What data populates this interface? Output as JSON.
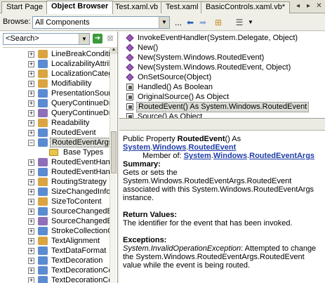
{
  "tabs": [
    {
      "label": "Start Page"
    },
    {
      "label": "Object Browser"
    },
    {
      "label": "Test.xaml.vb"
    },
    {
      "label": "Test.xaml"
    },
    {
      "label": "BasicControls.xaml.vb*"
    }
  ],
  "toolbar": {
    "browse_label": "Browse:",
    "browse_value": "All Components",
    "more_label": "..."
  },
  "search": {
    "placeholder": "<Search>"
  },
  "tree": [
    {
      "label": "LineBreakCondition",
      "icon_color": "#d9a441"
    },
    {
      "label": "LocalizabilityAttribut",
      "icon_color": "#5b8bd1"
    },
    {
      "label": "LocalizationCategor",
      "icon_color": "#d9a441"
    },
    {
      "label": "Modifiability",
      "icon_color": "#d9a441"
    },
    {
      "label": "PresentationSource",
      "icon_color": "#5b8bd1"
    },
    {
      "label": "QueryContinueDrag",
      "icon_color": "#5b8bd1"
    },
    {
      "label": "QueryContinueDrag",
      "icon_color": "#8e6fb8"
    },
    {
      "label": "Readability",
      "icon_color": "#d9a441"
    },
    {
      "label": "RoutedEvent",
      "icon_color": "#5b8bd1"
    },
    {
      "label": "RoutedEventArgs",
      "icon_color": "#5b8bd1"
    },
    {
      "label": "Base Types",
      "icon_color": "#e8c44c"
    },
    {
      "label": "RoutedEventHandle",
      "icon_color": "#8e6fb8"
    },
    {
      "label": "RoutedEventHandle",
      "icon_color": "#5b8bd1"
    },
    {
      "label": "RoutingStrategy",
      "icon_color": "#d9a441"
    },
    {
      "label": "SizeChangedInfo",
      "icon_color": "#5b8bd1"
    },
    {
      "label": "SizeToContent",
      "icon_color": "#d9a441"
    },
    {
      "label": "SourceChangedEve",
      "icon_color": "#5b8bd1"
    },
    {
      "label": "SourceChangedEve",
      "icon_color": "#8e6fb8"
    },
    {
      "label": "StrokeCollectionCor",
      "icon_color": "#5b8bd1"
    },
    {
      "label": "TextAlignment",
      "icon_color": "#d9a441"
    },
    {
      "label": "TextDataFormat",
      "icon_color": "#5b8bd1"
    },
    {
      "label": "TextDecoration",
      "icon_color": "#5b8bd1"
    },
    {
      "label": "TextDecorationColle",
      "icon_color": "#5b8bd1"
    },
    {
      "label": "TextDecorationColle",
      "icon_color": "#5b8bd1"
    }
  ],
  "members": [
    {
      "label": "InvokeEventHandler(System.Delegate, Object)",
      "kind": "method"
    },
    {
      "label": "New()",
      "kind": "method"
    },
    {
      "label": "New(System.Windows.RoutedEvent)",
      "kind": "method"
    },
    {
      "label": "New(System.Windows.RoutedEvent, Object)",
      "kind": "method"
    },
    {
      "label": "OnSetSource(Object)",
      "kind": "method"
    },
    {
      "label": "Handled() As Boolean",
      "kind": "property"
    },
    {
      "label": "OriginalSource() As Object",
      "kind": "property"
    },
    {
      "label": "RoutedEvent() As System.Windows.RoutedEvent",
      "kind": "property"
    },
    {
      "label": "Source() As Object",
      "kind": "property"
    }
  ],
  "description": {
    "sig_prefix": "Public Property ",
    "sig_name": "RoutedEvent",
    "sig_suffix": "() As",
    "type_ns1": "System",
    "type_ns2": "Windows",
    "type_name": "RoutedEvent",
    "member_of_label": "Member of: ",
    "member_ns1": "System",
    "member_ns2": "Windows",
    "member_class": "RoutedEventArgs",
    "summary_hdr": "Summary:",
    "summary_text": "Gets or sets the System.Windows.RoutedEventArgs.RoutedEvent associated with this System.Windows.RoutedEventArgs instance.",
    "return_hdr": "Return Values:",
    "return_text": "The identifier for the event that has been invoked.",
    "exceptions_hdr": "Exceptions:",
    "exception_type": "System.InvalidOperationException",
    "exception_text": ": Attempted to change the System.Windows.RoutedEventArgs.RoutedEvent value while the event is being routed."
  }
}
